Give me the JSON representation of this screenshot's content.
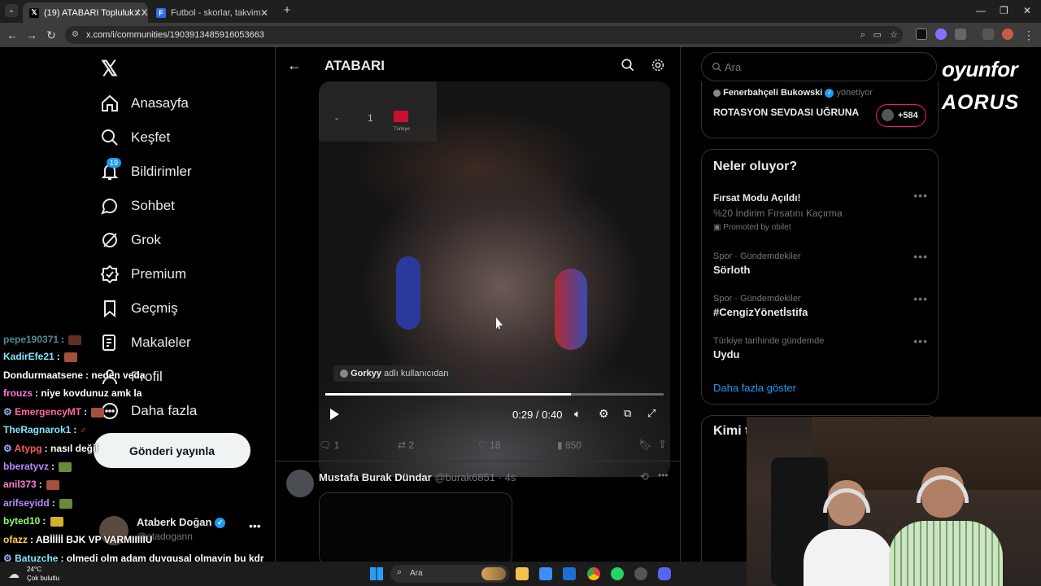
{
  "browser": {
    "tabs": [
      {
        "title": "(19) ATABARI Topluluk / X",
        "active": true
      },
      {
        "title": "Futbol - skorlar, takvim & oranlar",
        "active": false
      }
    ],
    "url": "x.com/i/communities/1903913485916053663"
  },
  "leftnav": {
    "items": [
      {
        "label": "Anasayfa",
        "icon": "home-icon"
      },
      {
        "label": "Keşfet",
        "icon": "search-icon"
      },
      {
        "label": "Bildirimler",
        "icon": "bell-icon",
        "badge": "19"
      },
      {
        "label": "Sohbet",
        "icon": "chat-icon"
      },
      {
        "label": "Grok",
        "icon": "grok-icon"
      },
      {
        "label": "Premium",
        "icon": "premium-icon"
      },
      {
        "label": "Geçmiş",
        "icon": "bookmark-icon"
      },
      {
        "label": "Makaleler",
        "icon": "articles-icon"
      },
      {
        "label": "Profil",
        "icon": "profile-icon"
      },
      {
        "label": "Daha fazla",
        "icon": "more-icon"
      }
    ],
    "post_button": "Gönderi yayınla",
    "account": {
      "name": "Ataberk Doğan",
      "handle": "@atadogann"
    }
  },
  "center": {
    "title": "ATABARI",
    "video": {
      "overlay_score": [
        "-",
        "1"
      ],
      "overlay_team": "Türkiye",
      "tag_user": "Gorkyy",
      "tag_suffix": "adlı kullanıcıdan",
      "time": "0:29 / 0:40",
      "progress": 0.725
    },
    "actions": {
      "replies": "1",
      "reposts": "2",
      "likes": "18",
      "views": "850"
    },
    "next_post": {
      "name": "Mustafa Burak Dündar",
      "handle": "@burak6851",
      "time": "4s"
    }
  },
  "right": {
    "search_placeholder": "Ara",
    "community": {
      "moderator": "Fenerbahçeli Bukowski",
      "moderator_role": "yönetiyor",
      "title": "ROTASYON SEVDASI UĞRUNA",
      "members": "+584"
    },
    "trends_title": "Neler oluyor?",
    "trends": [
      {
        "category": "",
        "title": "Fırsat Modu Açıldı!",
        "subtitle": "%20 İndirim Fırsatını Kaçırma",
        "promoted": "Promoted by obilet"
      },
      {
        "category": "Spor · Gündemdekiler",
        "title": "Sörloth"
      },
      {
        "category": "Spor · Gündemdekiler",
        "title": "#CengizYönetİstifa"
      },
      {
        "category": "Türkiye tarihinde gündemde",
        "title": "Uydu"
      }
    ],
    "show_more": "Daha fazla göster",
    "who_to_follow": "Kimi takip etmeli"
  },
  "sponsors": {
    "brand1": "oyunfor",
    "brand2": "AORUS"
  },
  "chat": [
    {
      "user": "pepe190371",
      "msg": "",
      "color": "#7fe7ff"
    },
    {
      "user": "KadirEfe21",
      "msg": "",
      "color": "#7fe7ff"
    },
    {
      "user": "Dondurmaatsene",
      "msg": "neden veda",
      "color": "#ffffff"
    },
    {
      "user": "frouzs",
      "msg": "niye kovdunuz amk la",
      "color": "#ff7ad9"
    },
    {
      "user": "EmergencyMT",
      "msg": "",
      "color": "#ff6aa2"
    },
    {
      "user": "TheRagnarok1",
      "msg": "",
      "color": "#7fe7ff"
    },
    {
      "user": "Atypg",
      "msg": "nasıl değil",
      "color": "#ff5a5a"
    },
    {
      "user": "bberatyvz",
      "msg": "",
      "color": "#b58cff"
    },
    {
      "user": "anil373",
      "msg": "",
      "color": "#ff7ad9"
    },
    {
      "user": "arifseyidd",
      "msg": "",
      "color": "#b58cff"
    },
    {
      "user": "byted10",
      "msg": "",
      "color": "#8cff6a"
    },
    {
      "user": "ofazz",
      "msg": "ABİİİİİ BJK VP VARMIIIIIU",
      "color": "#ffd24a"
    },
    {
      "user": "Batuzche",
      "msg": "olmedi olm adam duygusal olmayin bu kdr",
      "color": "#7fe7ff"
    }
  ],
  "taskbar": {
    "weather_temp": "24°C",
    "weather_desc": "Çok bulutlu",
    "search": "Ara"
  },
  "colors": {
    "accent": "#1d9bf0",
    "verified": "#1d9bf0",
    "badge": "#1d9bf0",
    "community_border": "#f91880"
  }
}
